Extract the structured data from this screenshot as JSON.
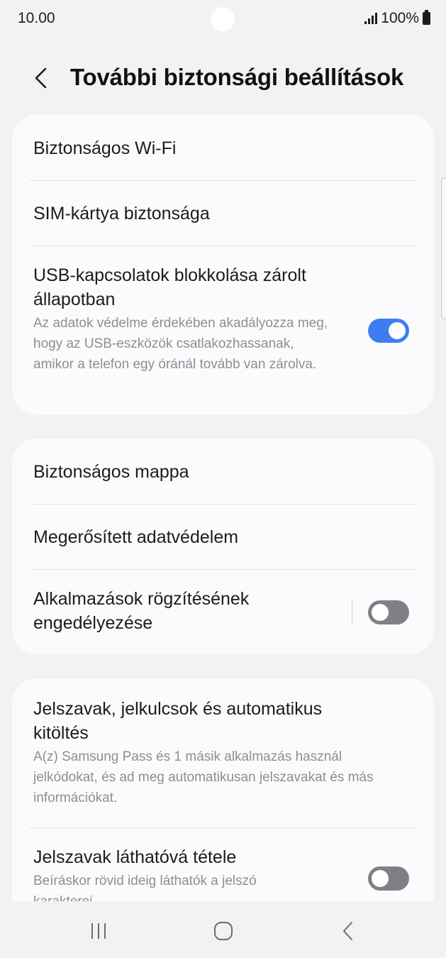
{
  "status_bar": {
    "time": "10.00",
    "battery": "100%"
  },
  "header": {
    "title": "További biztonsági beállítások"
  },
  "card1": {
    "secure_wifi": "Biztonságos Wi-Fi",
    "sim_security": "SIM-kártya biztonsága",
    "usb_block": {
      "title": "USB-kapcsolatok blokkolása zárolt állapotban",
      "subtitle": "Az adatok védelme érdekében akadályozza meg, hogy az USB-eszközök csatlakozhassanak, amikor a telefon egy óránál tovább van zárolva.",
      "enabled": true
    }
  },
  "card2": {
    "secure_folder": "Biztonságos mappa",
    "enhanced_privacy": "Megerősített adatvédelem",
    "app_pinning": {
      "title": "Alkalmazások rögzítésének engedélyezése",
      "enabled": false
    }
  },
  "card3": {
    "passwords": {
      "title": "Jelszavak, jelkulcsok és automatikus kitöltés",
      "subtitle": "A(z) Samsung Pass és 1 másik alkalmazás használ jelkódokat, és ad meg automatikusan jelszavakat és más információkat."
    },
    "show_passwords": {
      "title": "Jelszavak láthatóvá tétele",
      "subtitle": "Beíráskor rövid ideig láthatók a jelszó karakterei",
      "enabled": false
    }
  },
  "colors": {
    "background": "#f2f2f4",
    "card": "#fbfbfe",
    "toggle_on": "#3e7cf3",
    "toggle_off": "#7f7f86",
    "secondary_text": "#8e8e93"
  }
}
